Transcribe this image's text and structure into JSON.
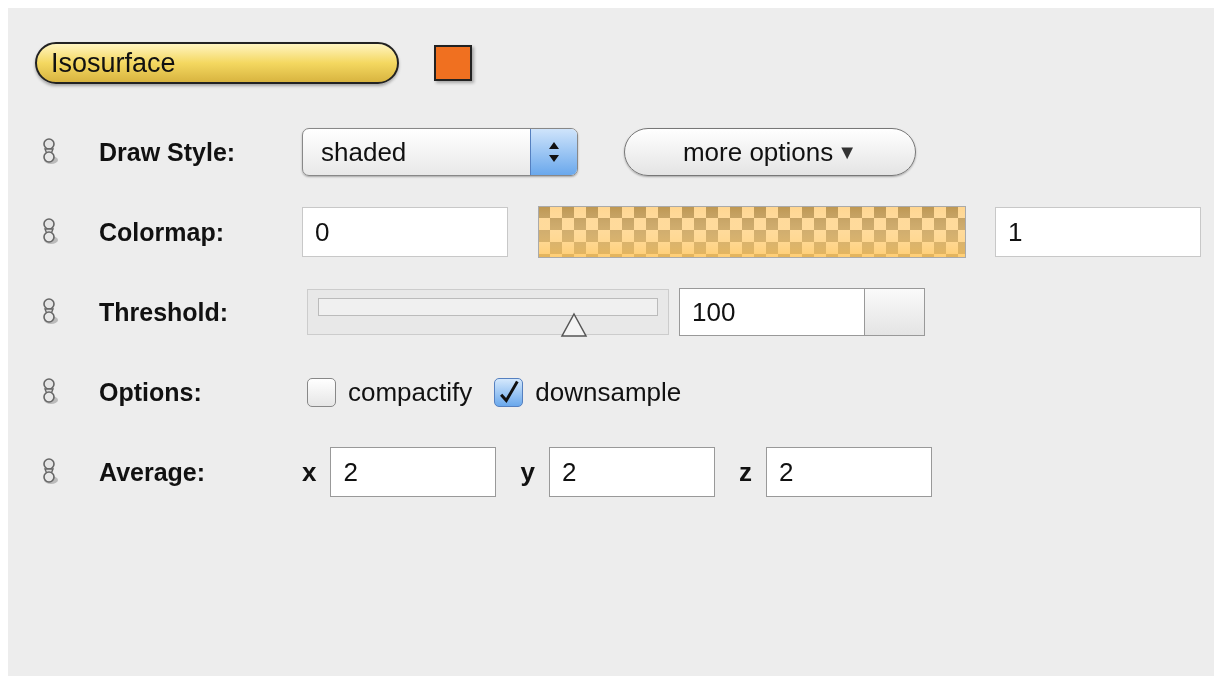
{
  "header": {
    "label": "Isosurface",
    "color": "#f07020"
  },
  "rows": [
    {
      "kind": "select",
      "label": "Draw Style:",
      "value": "shaded",
      "button": "more options",
      "button_caret": "▼"
    },
    {
      "kind": "range",
      "label": "Colormap:",
      "min": "0",
      "max": "1"
    },
    {
      "kind": "slider",
      "label": "Threshold:",
      "level": 0.74,
      "value": "100"
    },
    {
      "kind": "checks",
      "label": "Options:",
      "options": [
        {
          "label": "compactify",
          "checked": false
        },
        {
          "label": "downsample",
          "checked": true
        }
      ]
    },
    {
      "kind": "xyz",
      "label": "Average:",
      "fields": [
        {
          "axis": "x",
          "value": "2"
        },
        {
          "axis": "y",
          "value": "2"
        },
        {
          "axis": "z",
          "value": "2"
        }
      ]
    }
  ]
}
